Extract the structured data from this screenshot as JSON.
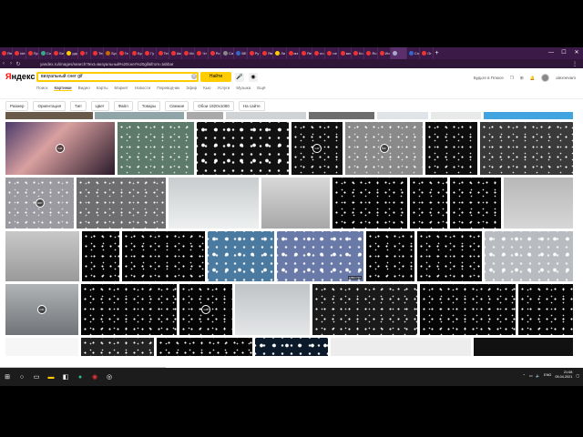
{
  "browser": {
    "tabs": [
      {
        "label": "Яндекс",
        "color": "#e33"
      },
      {
        "label": "ide",
        "color": "#e33"
      },
      {
        "label": "Пр",
        "color": "#e33"
      },
      {
        "label": "Соз",
        "color": "#3a8"
      },
      {
        "label": "Бе",
        "color": "#e33"
      },
      {
        "label": "рдо",
        "color": "#fc0"
      },
      {
        "label": "Т",
        "color": "#e33"
      },
      {
        "label": "Тех",
        "color": "#e33"
      },
      {
        "label": "Буз",
        "color": "#c60"
      },
      {
        "label": "Ге",
        "color": "#e33"
      },
      {
        "label": "Бро",
        "color": "#e33"
      },
      {
        "label": "Гу",
        "color": "#e33"
      },
      {
        "label": "Tel",
        "color": "#e33"
      },
      {
        "label": "Ав",
        "color": "#e33"
      },
      {
        "label": "Мо",
        "color": "#e33"
      },
      {
        "label": "Чт",
        "color": "#e33"
      },
      {
        "label": "Ро",
        "color": "#e33"
      },
      {
        "label": "Са",
        "color": "#888"
      },
      {
        "label": "BE",
        "color": "#36c"
      },
      {
        "label": "Ру",
        "color": "#e33"
      },
      {
        "label": "Яв",
        "color": "#e33"
      },
      {
        "label": "Ли",
        "color": "#fc0"
      },
      {
        "label": "мэ",
        "color": "#e33"
      },
      {
        "label": "Яе",
        "color": "#e33"
      },
      {
        "label": "но",
        "color": "#e33"
      },
      {
        "label": "пе",
        "color": "#e33"
      },
      {
        "label": "ми",
        "color": "#e33"
      },
      {
        "label": "Ко",
        "color": "#e33"
      },
      {
        "label": "Яо",
        "color": "#e33"
      },
      {
        "label": "Ин",
        "color": "#e33"
      },
      {
        "label": "",
        "color": "#aac",
        "active": true
      },
      {
        "label": "Сп",
        "color": "#36c"
      },
      {
        "label": "Gr",
        "color": "#e33"
      }
    ],
    "new_tab": "+",
    "url": "yandex.ru/images/search?text=визуальный%20снег%20gif&from=tabbar"
  },
  "yandex": {
    "logo_main": "Яндекс",
    "search_value": "визуальный снег gif",
    "find_button": "Найти",
    "services": [
      "Поиск",
      "Картинки",
      "Видео",
      "Карты",
      "Маркет",
      "Новости",
      "Переводчик",
      "Эфир",
      "Кью",
      "Услуги",
      "Музыка",
      "Ещё"
    ],
    "active_service": "Картинки",
    "hdr_link": "Будьте в Плюсе",
    "username": "alexnevam",
    "notif_count": "1"
  },
  "filters": [
    "Размер",
    "Ориентация",
    "Тип",
    "Цвет",
    "Файл",
    "Товары",
    "Свежие",
    "Обои 1920x1080",
    "На сайте"
  ],
  "tiles": [
    {
      "label": "",
      "badge": "GIF"
    },
    {
      "label": "",
      "badge": "GIF"
    },
    {
      "label": "",
      "badge": "GIF"
    },
    {
      "label": "",
      "badge": "GIF"
    },
    {
      "label": "",
      "badge": "GIF"
    },
    {
      "label": "",
      "badge": "GIF"
    }
  ],
  "res_label": "1280×720",
  "status_url": "http://yandex.ru/images/search?pos=24&from=tabbar&img_url=https%3A%2F%2Fwww.tenor.com%2Fview%2F...",
  "taskbar": {
    "lang": "ENG",
    "time": "21:08",
    "date": "05.04.2021"
  },
  "colors": {
    "yandex_yellow": "#fc0",
    "yandex_red": "#f00",
    "tab_bg": "#3b1a47"
  }
}
